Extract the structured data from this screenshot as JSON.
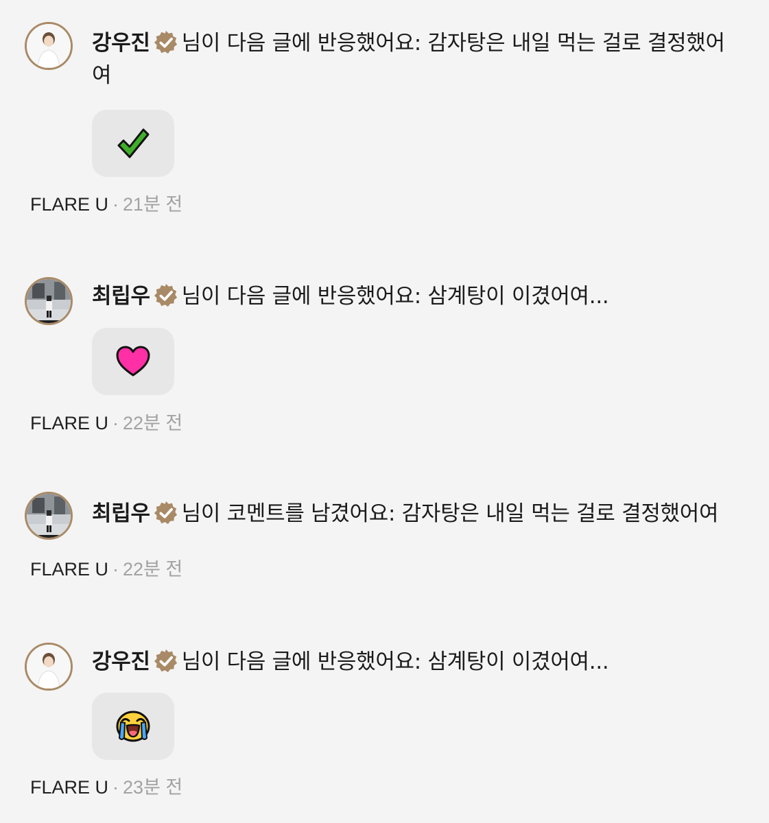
{
  "notifications": [
    {
      "username": "강우진",
      "message": "님이 다음 글에 반응했어요: 감자탕은 내일 먹는 걸로 결정했어여",
      "reaction": "check-mark-icon",
      "source": "FLARE U",
      "separator": "·",
      "time": "21분 전"
    },
    {
      "username": "최립우",
      "message": "님이 다음 글에 반응했어요: 삼계탕이 이겼어여...",
      "reaction": "heart-icon",
      "source": "FLARE U",
      "separator": "·",
      "time": "22분 전"
    },
    {
      "username": "최립우",
      "message": "님이 코멘트를 남겼어요: 감자탕은 내일 먹는 걸로 결정했어여",
      "reaction": null,
      "source": "FLARE U",
      "separator": "·",
      "time": "22분 전"
    },
    {
      "username": "강우진",
      "message": "님이 다음 글에 반응했어요: 삼계탕이 이겼어여...",
      "reaction": "crying-face-icon",
      "source": "FLARE U",
      "separator": "·",
      "time": "23분 전"
    }
  ],
  "colors": {
    "background": "#f4f4f4",
    "badge": "#a98a66",
    "reaction_box": "#e7e7e7",
    "check": "#3fae2a",
    "heart": "#ff2fa5",
    "time_text": "#a2a2a2"
  }
}
